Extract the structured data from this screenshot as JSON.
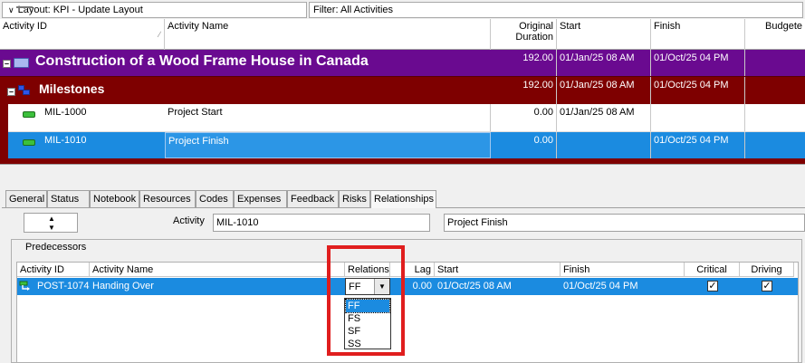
{
  "topbar": {
    "layout": "Layout: KPI - Update Layout",
    "filter": "Filter: All Activities"
  },
  "grid": {
    "columns": {
      "activity_id": "Activity ID",
      "activity_name": "Activity Name",
      "original_duration_line1": "Original",
      "original_duration_line2": "Duration",
      "start": "Start",
      "finish": "Finish",
      "budgeted": "Budgete"
    },
    "rows": [
      {
        "name": "Construction of a Wood Frame House in Canada",
        "duration": "192.00",
        "start": "01/Jan/25 08 AM",
        "finish": "01/Oct/25 04 PM"
      },
      {
        "name": "Milestones",
        "duration": "192.00",
        "start": "01/Jan/25 08 AM",
        "finish": "01/Oct/25 04 PM"
      },
      {
        "id": "MIL-1000",
        "name": "Project Start",
        "duration": "0.00",
        "start": "01/Jan/25 08 AM",
        "finish": ""
      },
      {
        "id": "MIL-1010",
        "name": "Project Finish",
        "duration": "0.00",
        "start": "",
        "finish": "01/Oct/25 04 PM"
      }
    ]
  },
  "tabs": [
    "General",
    "Status",
    "Notebook",
    "Resources",
    "Codes",
    "Expenses",
    "Feedback",
    "Risks",
    "Relationships"
  ],
  "active_tab": "Relationships",
  "detail": {
    "activity_label": "Activity",
    "activity_id": "MIL-1010",
    "activity_name": "Project Finish"
  },
  "predecessors": {
    "title": "Predecessors",
    "columns": {
      "activity_id": "Activity ID",
      "activity_name": "Activity Name",
      "relations": "Relations",
      "lag": "Lag",
      "start": "Start",
      "finish": "Finish",
      "critical": "Critical",
      "driving": "Driving"
    },
    "row": {
      "activity_id": "POST-1074",
      "activity_name": "Handing Over",
      "relation": "FF",
      "lag": "0.00",
      "start": "01/Oct/25 08 AM",
      "finish": "01/Oct/25 04 PM",
      "critical": true,
      "driving": true
    },
    "relation_options": [
      "FF",
      "FS",
      "SF",
      "SS"
    ],
    "selected_option": "FF"
  },
  "colors": {
    "project_band": "#6a0a90",
    "wbs_band": "#7e0000",
    "selection": "#1b8be0",
    "highlight": "#e01e1e"
  }
}
